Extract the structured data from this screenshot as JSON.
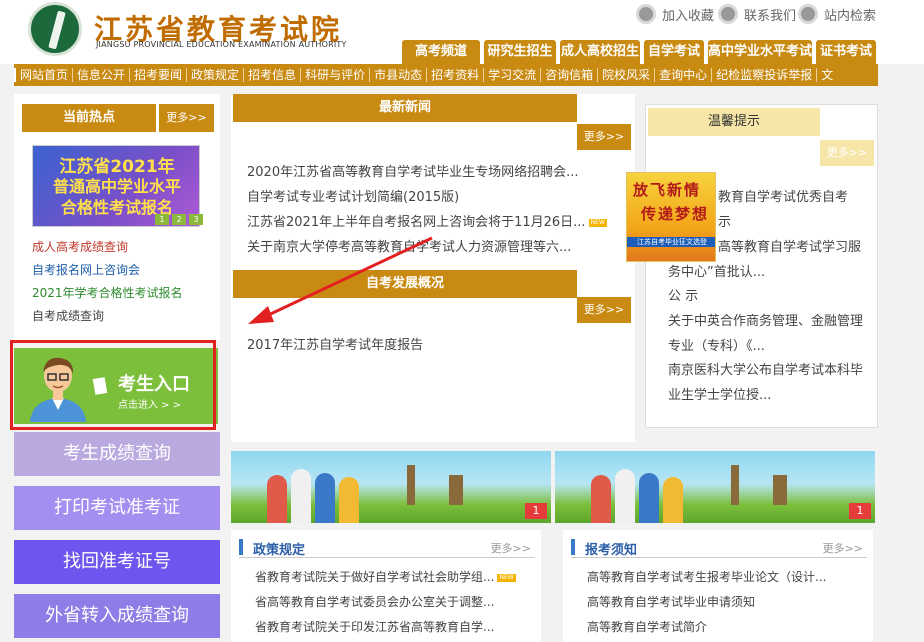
{
  "header": {
    "site_title": "江苏省教育考试院",
    "site_subtitle": "JIANGSU PROVINCIAL EDUCATION EXAMINATION AUTHORITY",
    "top_links": [
      "加入收藏",
      "联系我们",
      "站内检索"
    ]
  },
  "category_tabs": [
    "高考频道",
    "研究生招生",
    "成人高校招生",
    "自学考试",
    "高中学业水平考试",
    "证书考试"
  ],
  "nav": [
    "网站首页",
    "信息公开",
    "招考要闻",
    "政策规定",
    "招考信息",
    "科研与评价",
    "市县动态",
    "招考资料",
    "学习交流",
    "咨询信箱",
    "院校风采",
    "查询中心",
    "纪检监察投诉举报",
    "文"
  ],
  "hot": {
    "title": "当前热点",
    "more": "更多>>",
    "banner": {
      "line1": "江苏省2021年",
      "line2": "普通高中学业水平",
      "line3": "合格性考试报名",
      "pages": [
        "1",
        "2",
        "3"
      ]
    },
    "links": [
      {
        "text": "成人高考成绩查询",
        "color": "#c0392b"
      },
      {
        "text": "自考报名网上咨询会",
        "color": "#1f5fa8"
      },
      {
        "text": "2021年学考合格性考试报名",
        "color": "#2d8a2d"
      },
      {
        "text": "自考成绩查询",
        "color": "#444444"
      }
    ]
  },
  "entry": {
    "title": "考生入口",
    "subtitle": "点击进入 > >"
  },
  "quick_buttons": [
    {
      "label": "考生成绩查询",
      "color": "#b9a9df"
    },
    {
      "label": "打印考试准考证",
      "color": "#a48ef0"
    },
    {
      "label": "找回准考证号",
      "color": "#6f54ee"
    },
    {
      "label": "外省转入成绩查询",
      "color": "#8c7ee6"
    }
  ],
  "latest_news": {
    "title": "最新新闻",
    "more": "更多>>",
    "items": [
      {
        "text": "2020年江苏省高等教育自学考试毕业生专场网络招聘会...",
        "is_new": false
      },
      {
        "text": "自学考试专业考试计划简编(2015版)",
        "is_new": false
      },
      {
        "text": "江苏省2021年上半年自考报名网上咨询会将于11月26日...",
        "is_new": true
      },
      {
        "text": "关于南京大学停考高等教育自学考试人力资源管理等六...",
        "is_new": false
      }
    ]
  },
  "development": {
    "title": "自考发展概况",
    "more": "更多>>",
    "items": [
      "2017年江苏自学考试年度报告"
    ]
  },
  "tips": {
    "title": "温馨提示",
    "more": "更多>>",
    "lines": [
      "教育自学考试优秀自考",
      "示",
      "高等教育自学考试学习服",
      "务中心”首批认...",
      "公 示",
      "关于中英合作商务管理、金融管理",
      "专业（专科）《...",
      "南京医科大学公布自学考试本科毕",
      "业生学士学位授..."
    ]
  },
  "float_ad": {
    "line1": "放飞新情",
    "line2": "传递梦想",
    "line3": "江苏自考毕业征文选登"
  },
  "banners": [
    {
      "badge": "1"
    },
    {
      "badge": "1"
    }
  ],
  "policy": {
    "title": "政策规定",
    "more": "更多>>",
    "items": [
      {
        "text": "省教育考试院关于做好自学考试社会助学组...",
        "is_new": true
      },
      {
        "text": "省高等教育自学考试委员会办公室关于调整...",
        "is_new": false
      },
      {
        "text": "省教育考试院关于印发江苏省高等教育自学...",
        "is_new": false
      }
    ]
  },
  "notice": {
    "title": "报考须知",
    "more": "更多>>",
    "items": [
      "高等教育自学考试考生报考毕业论文（设计...",
      "高等教育自学考试毕业申请须知",
      "高等教育自学考试简介"
    ]
  }
}
